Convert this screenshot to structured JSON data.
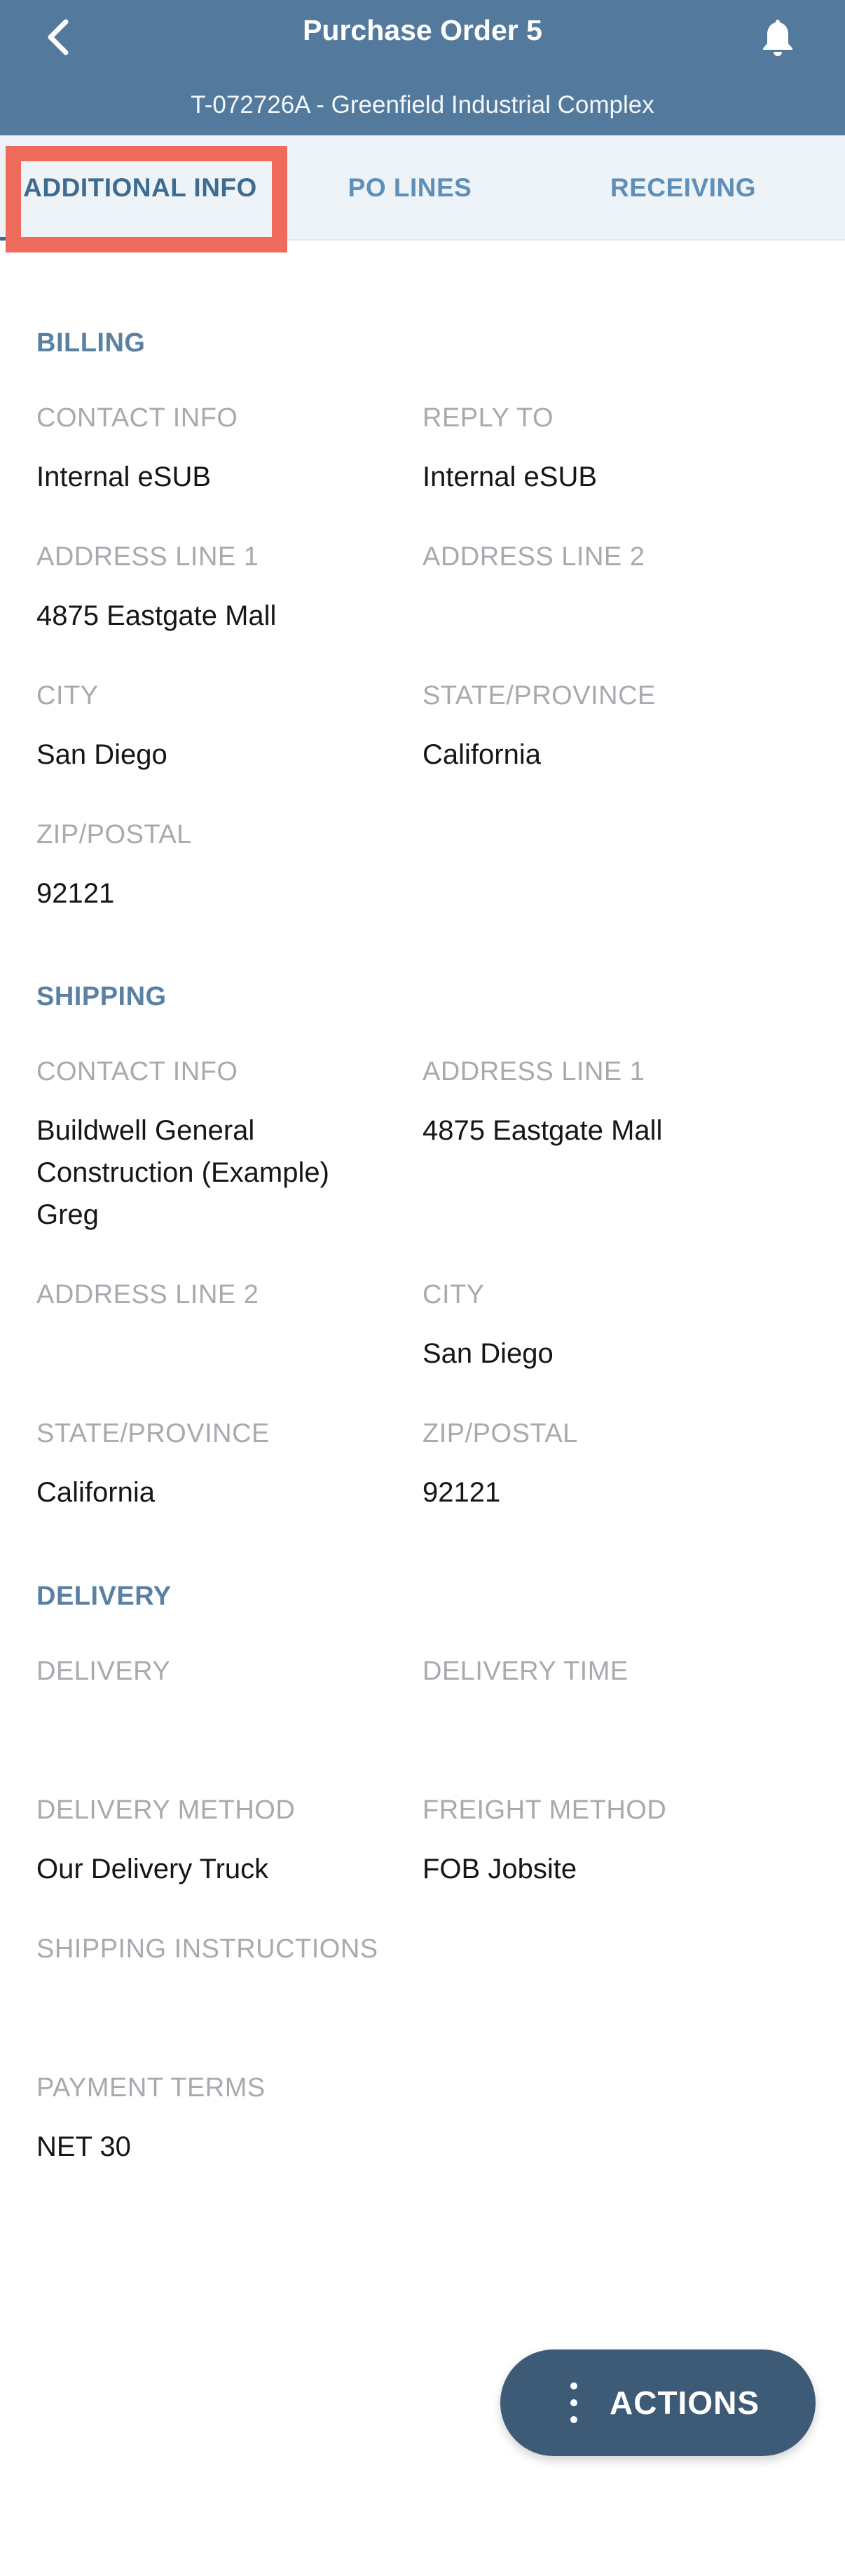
{
  "header": {
    "title": "Purchase Order 5",
    "subtitle": "T-072726A - Greenfield Industrial Complex",
    "back_icon": "chevron-left-icon",
    "bell_icon": "bell-icon"
  },
  "tabs": [
    {
      "label": "ADDITIONAL INFO",
      "active": true
    },
    {
      "label": "PO LINES",
      "active": false
    },
    {
      "label": "RECEIVING",
      "active": false
    }
  ],
  "billing": {
    "title": "BILLING",
    "contact_info_label": "CONTACT INFO",
    "contact_info_value": "Internal eSUB",
    "reply_to_label": "REPLY TO",
    "reply_to_value": "Internal eSUB",
    "address1_label": "ADDRESS LINE 1",
    "address1_value": "4875 Eastgate Mall",
    "address2_label": "ADDRESS LINE 2",
    "address2_value": "",
    "city_label": "CITY",
    "city_value": "San Diego",
    "state_label": "STATE/PROVINCE",
    "state_value": "California",
    "zip_label": "ZIP/POSTAL",
    "zip_value": "92121"
  },
  "shipping": {
    "title": "SHIPPING",
    "contact_info_label": "CONTACT INFO",
    "contact_info_line1": "Buildwell General",
    "contact_info_line2": "Construction (Example)",
    "contact_info_line3": "Greg",
    "address1_label": "ADDRESS LINE 1",
    "address1_value": "4875 Eastgate Mall",
    "address2_label": "ADDRESS LINE 2",
    "address2_value": "",
    "city_label": "CITY",
    "city_value": "San Diego",
    "state_label": "STATE/PROVINCE",
    "state_value": "California",
    "zip_label": "ZIP/POSTAL",
    "zip_value": "92121"
  },
  "delivery": {
    "title": "DELIVERY",
    "delivery_label": "DELIVERY",
    "delivery_value": "",
    "delivery_time_label": "DELIVERY TIME",
    "delivery_time_value": "",
    "delivery_method_label": "DELIVERY METHOD",
    "delivery_method_value": "Our Delivery Truck",
    "freight_method_label": "FREIGHT METHOD",
    "freight_method_value": "FOB Jobsite",
    "shipping_instructions_label": "SHIPPING INSTRUCTIONS",
    "shipping_instructions_value": "",
    "payment_terms_label": "PAYMENT TERMS",
    "payment_terms_value": "NET 30"
  },
  "actions": {
    "label": "ACTIONS",
    "icon": "kebab-menu-icon"
  },
  "colors": {
    "header_bg": "#537a9c",
    "tab_text": "#5e8fb8",
    "section_header": "#5a80a3",
    "label": "#a7aaae",
    "highlight": "#ee6a5c",
    "actions_bg": "#3d5a77"
  }
}
